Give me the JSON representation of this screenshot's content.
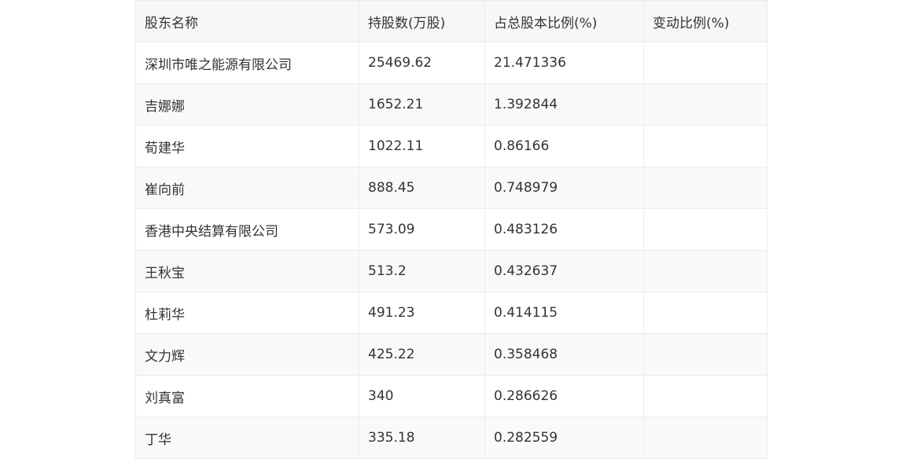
{
  "table": {
    "headers": [
      "股东名称",
      "持股数(万股)",
      "占总股本比例(%)",
      "变动比例(%)"
    ],
    "rows": [
      [
        "深圳市唯之能源有限公司",
        "25469.62",
        "21.471336",
        ""
      ],
      [
        "吉娜娜",
        "1652.21",
        "1.392844",
        ""
      ],
      [
        "荀建华",
        "1022.11",
        "0.86166",
        ""
      ],
      [
        "崔向前",
        "888.45",
        "0.748979",
        ""
      ],
      [
        "香港中央结算有限公司",
        "573.09",
        "0.483126",
        ""
      ],
      [
        "王秋宝",
        "513.2",
        "0.432637",
        ""
      ],
      [
        "杜莉华",
        "491.23",
        "0.414115",
        ""
      ],
      [
        "文力辉",
        "425.22",
        "0.358468",
        ""
      ],
      [
        "刘真富",
        "340",
        "0.286626",
        ""
      ],
      [
        "丁华",
        "335.18",
        "0.282559",
        ""
      ]
    ]
  }
}
